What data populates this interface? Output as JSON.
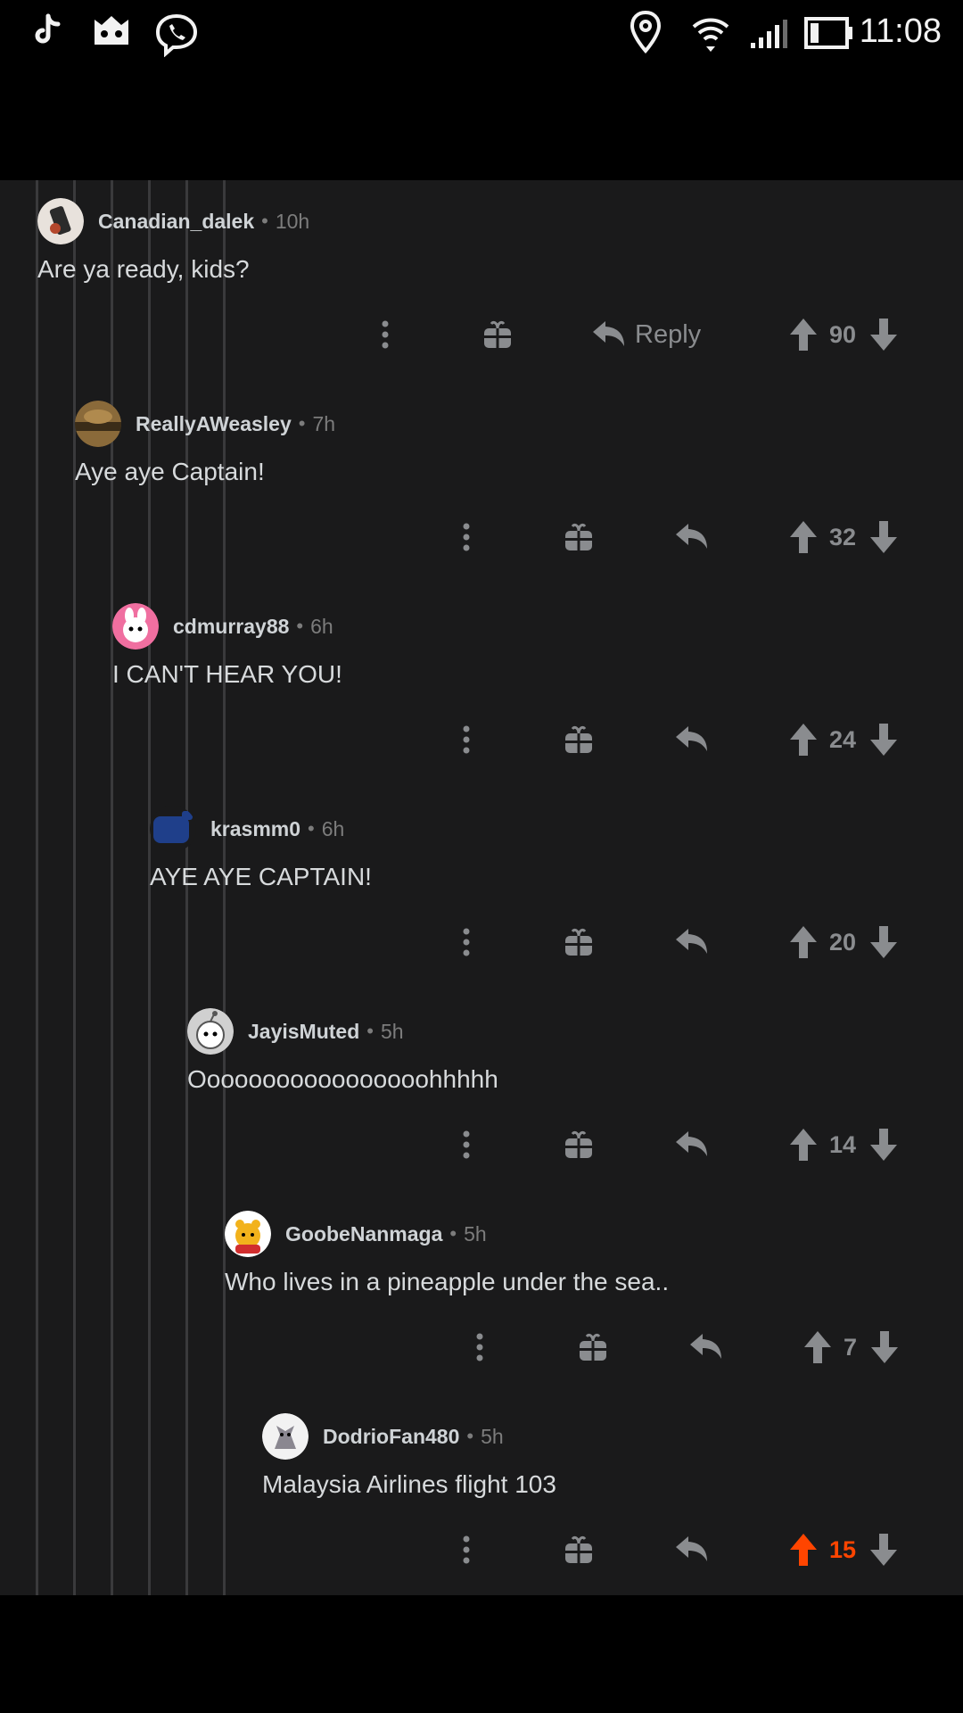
{
  "status_bar": {
    "time": "11:08",
    "left_icons": [
      "tiktok-icon",
      "game-controller-icon",
      "viber-icon"
    ],
    "right_icons": [
      "location-icon",
      "wifi-icon",
      "signal-icon",
      "battery-icon"
    ]
  },
  "colors": {
    "background": "#1a1a1b",
    "text": "#d7dadc",
    "muted": "#7c7c7c",
    "action": "#8a8c8f",
    "upvote_active": "#ff4500"
  },
  "comments": [
    {
      "username": "Canadian_dalek",
      "time": "10h",
      "body": "Are ya ready, kids?",
      "reply_label": "Reply",
      "score": "90",
      "upvoted": false
    },
    {
      "username": "ReallyAWeasley",
      "time": "7h",
      "body": "Aye aye Captain!",
      "score": "32",
      "upvoted": false
    },
    {
      "username": "cdmurray88",
      "time": "6h",
      "body": "I CAN'T HEAR YOU!",
      "score": "24",
      "upvoted": false
    },
    {
      "username": "krasmm0",
      "time": "6h",
      "body": "AYE AYE CAPTAIN!",
      "score": "20",
      "upvoted": false
    },
    {
      "username": "JayisMuted",
      "time": "5h",
      "body": "Ooooooooooooooooohhhhh",
      "score": "14",
      "upvoted": false
    },
    {
      "username": "GoobeNanmaga",
      "time": "5h",
      "body": "Who lives in a pineapple under the sea..",
      "score": "7",
      "upvoted": false
    },
    {
      "username": "DodrioFan480",
      "time": "5h",
      "body": "Malaysia Airlines flight 103",
      "score": "15",
      "upvoted": true
    }
  ]
}
